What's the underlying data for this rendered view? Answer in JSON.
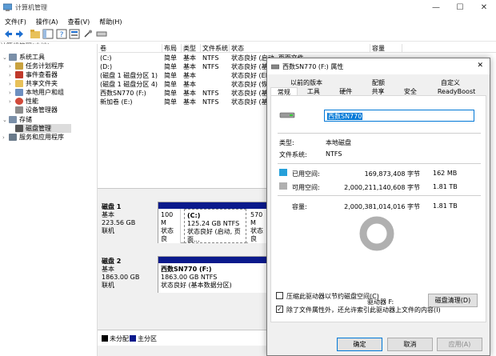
{
  "window": {
    "title": "计算机管理",
    "min": "—",
    "max": "☐",
    "close": "✕"
  },
  "menu": [
    "文件(F)",
    "操作(A)",
    "查看(V)",
    "帮助(H)"
  ],
  "tree_header": "计算机管理(本地)",
  "tree": [
    {
      "label": "系统工具",
      "level": 1,
      "expand": "⌄"
    },
    {
      "label": "任务计划程序",
      "level": 2,
      "expand": "›"
    },
    {
      "label": "事件查看器",
      "level": 2,
      "expand": "›"
    },
    {
      "label": "共享文件夹",
      "level": 2,
      "expand": "›"
    },
    {
      "label": "本地用户和组",
      "level": 2,
      "expand": "›"
    },
    {
      "label": "性能",
      "level": 2,
      "expand": "›"
    },
    {
      "label": "设备管理器",
      "level": 2,
      "expand": ""
    },
    {
      "label": "存储",
      "level": 1,
      "expand": "⌄"
    },
    {
      "label": "磁盘管理",
      "level": 2,
      "expand": ""
    },
    {
      "label": "服务和应用程序",
      "level": 1,
      "expand": "›"
    }
  ],
  "columns": [
    "卷",
    "布局",
    "类型",
    "文件系统",
    "状态",
    "容量"
  ],
  "volumes": [
    {
      "name": "(C:)",
      "layout": "简单",
      "type": "基本",
      "fs": "NTFS",
      "status": "状态良好 (启动, 页面文件..."
    },
    {
      "name": "(D:)",
      "layout": "简单",
      "type": "基本",
      "fs": "NTFS",
      "status": "状态良好 (基本数据分区)"
    },
    {
      "name": "(磁盘 1 磁盘分区 1)",
      "layout": "简单",
      "type": "基本",
      "fs": "",
      "status": "状态良好 (EFI 系统分区)"
    },
    {
      "name": "(磁盘 1 磁盘分区 4)",
      "layout": "简单",
      "type": "基本",
      "fs": "",
      "status": "状态良好 (恢复分区)"
    },
    {
      "name": "西数SN770 (F:)",
      "layout": "简单",
      "type": "基本",
      "fs": "NTFS",
      "status": "状态良好 (基本数据分区)"
    },
    {
      "name": "新加卷 (E:)",
      "layout": "简单",
      "type": "基本",
      "fs": "NTFS",
      "status": "状态良好 (基本数据分区)"
    }
  ],
  "disks": [
    {
      "name": "磁盘 1",
      "kind": "基本",
      "size": "223.56 GB",
      "state": "联机",
      "p1": [
        "100 M",
        "状态良"
      ],
      "p2": [
        "(C:)",
        "125.24 GB NTFS",
        "状态良好 (启动, 页面..."
      ],
      "p3": [
        "570 M",
        "状态良"
      ]
    },
    {
      "name": "磁盘 2",
      "kind": "基本",
      "size": "1863.00 GB",
      "state": "联机",
      "p1": [
        "西数SN770  (F:)",
        "1863.00 GB NTFS",
        "状态良好 (基本数据分区)"
      ]
    }
  ],
  "legend": {
    "unalloc": "未分配",
    "primary": "主分区"
  },
  "dialog": {
    "title": "西数SN770 (F:) 属性",
    "close": "✕",
    "tabs_top": [
      "以前的版本",
      "配额",
      "自定义"
    ],
    "tabs_bottom": [
      "常规",
      "工具",
      "硬件",
      "共享",
      "安全",
      "ReadyBoost"
    ],
    "volume_name": "西数SN770",
    "type_label": "类型:",
    "type_value": "本地磁盘",
    "fs_label": "文件系统:",
    "fs_value": "NTFS",
    "used_label": "已用空间:",
    "used_bytes": "169,873,408 字节",
    "used_size": "162 MB",
    "free_label": "可用空间:",
    "free_bytes": "2,000,211,140,608 字节",
    "free_size": "1.81 TB",
    "cap_label": "容量:",
    "cap_bytes": "2,000,381,014,016 字节",
    "cap_size": "1.81 TB",
    "drive_label": "驱动器 F:",
    "cleanup": "磁盘清理(D)",
    "compress": "压缩此驱动器以节约磁盘空间(C)",
    "index": "除了文件属性外，还允许索引此驱动器上文件的内容(I)",
    "ok": "确定",
    "cancel": "取消",
    "apply": "应用(A)",
    "used_color": "#26a0da",
    "free_color": "#b0b0b0",
    "used_fraction": 8.49e-05
  }
}
